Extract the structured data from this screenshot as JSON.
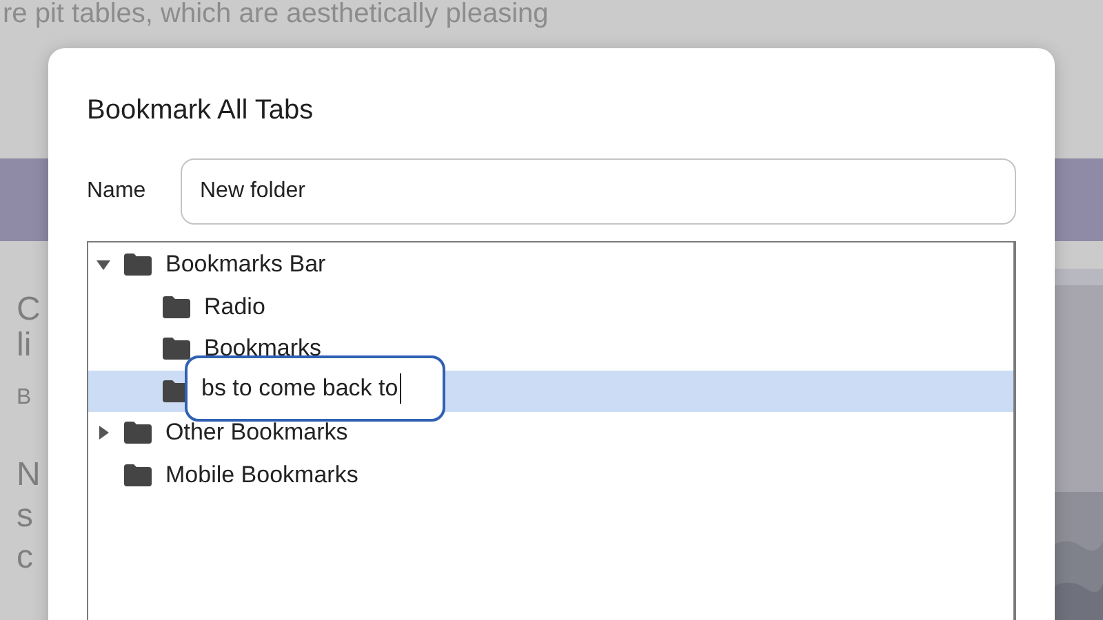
{
  "background": {
    "heading_fragment": "re pit tables, which are aesthetically pleasing",
    "side_fragments": [
      "C",
      "li",
      "B",
      "N",
      "s",
      "c"
    ]
  },
  "dialog": {
    "title": "Bookmark All Tabs",
    "name_label": "Name",
    "name_value": "New folder",
    "tree": [
      {
        "label": "Bookmarks Bar",
        "expanded": true,
        "selected": false,
        "children": [
          {
            "label": "Radio",
            "selected": false
          },
          {
            "label": "Bookmarks",
            "selected": false
          },
          {
            "editor_value": "bs to come back to",
            "selected": true
          }
        ]
      },
      {
        "label": "Other Bookmarks",
        "expanded": false,
        "selected": false
      },
      {
        "label": "Mobile Bookmarks",
        "selected": false
      }
    ]
  }
}
